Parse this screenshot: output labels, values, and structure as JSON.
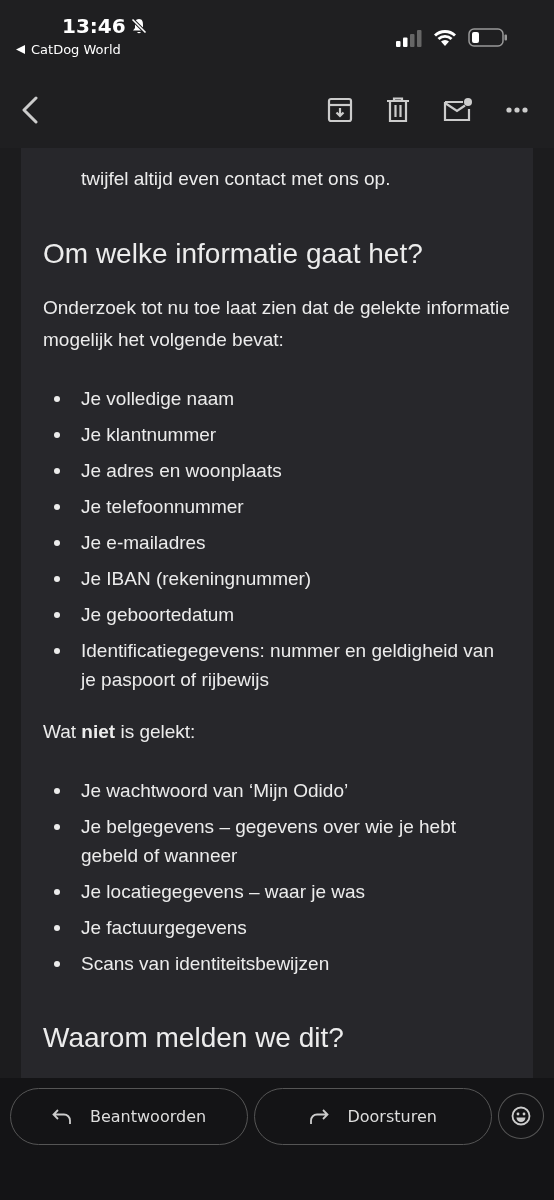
{
  "status_bar": {
    "time": "13:46",
    "back_app": "CatDog World"
  },
  "email": {
    "intro_tail": "twijfel altijd even contact met ons op.",
    "blocks": [
      {
        "kind": "heading",
        "text": "Om welke informatie gaat het?"
      },
      {
        "kind": "paragraph",
        "text": "Onderzoek tot nu toe laat zien dat de gelekte informatie mogelijk het volgende bevat:"
      },
      {
        "kind": "list",
        "items": [
          "Je volledige naam",
          "Je klantnummer",
          "Je adres en woonplaats",
          "Je telefoonnummer",
          "Je e-mailadres",
          "Je IBAN (rekeningnummer)",
          "Je geboortedatum",
          "Identificatiegegevens: nummer en geldigheid van je paspoort of rijbewijs"
        ]
      },
      {
        "kind": "paragraph",
        "text": "Wat **niet** is gelekt:"
      },
      {
        "kind": "list",
        "items": [
          "Je wachtwoord van ‘Mijn Odido’",
          "Je belgegevens – gegevens over wie je hebt gebeld of wanneer",
          "Je locatiegegevens – waar je was",
          "Je factuurgegevens",
          "Scans van identiteitsbewijzen"
        ]
      },
      {
        "kind": "heading",
        "text": "Waarom melden we dit?"
      }
    ]
  },
  "actions": [
    {
      "kind": "reply",
      "label": "Beantwoorden"
    },
    {
      "kind": "forward",
      "label": "Doorsturen"
    }
  ]
}
